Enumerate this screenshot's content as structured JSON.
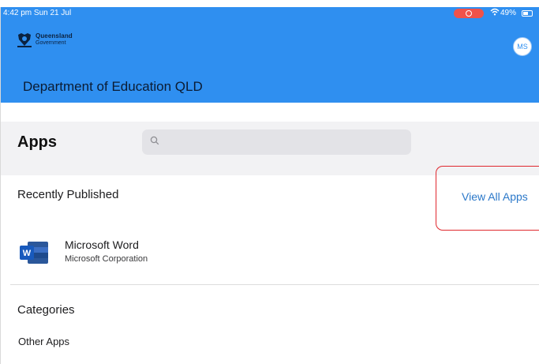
{
  "status_bar": {
    "time": "4:42 pm  Sun 21 Jul",
    "battery": "49%",
    "icons": [
      "screen-recording-icon",
      "wifi-icon",
      "battery-icon"
    ]
  },
  "header": {
    "logo_title": "Queensland",
    "logo_subtitle": "Government",
    "avatar_initials": "MS",
    "org_title": "Department of Education QLD",
    "background_color": "#2f8ff0"
  },
  "apps_bar": {
    "title": "Apps",
    "search_value": "",
    "search_placeholder": ""
  },
  "recently_published": {
    "title": "Recently Published",
    "view_all_label": "View All Apps",
    "apps": [
      {
        "name": "Microsoft Word",
        "publisher": "Microsoft Corporation",
        "icon": "microsoft-word-icon"
      }
    ]
  },
  "categories": {
    "title": "Categories",
    "items": [
      "Other Apps"
    ]
  },
  "accent_colors": {
    "link": "#2b78c9",
    "highlight": "#e0282e"
  }
}
